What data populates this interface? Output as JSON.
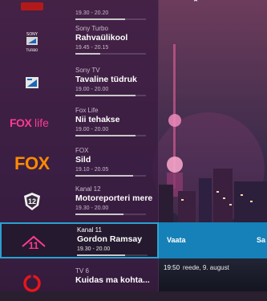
{
  "rows": [
    {
      "channel": "",
      "title": "",
      "time": "19.30 - 20.20",
      "progress": 0.7,
      "logo_text": "",
      "logo": "tv-logo-cropped",
      "favorite": true
    },
    {
      "channel": "Sony Turbo",
      "title": "Rahvaülikool",
      "time": "19.45 - 20.15",
      "progress": 0.35,
      "logo_text": "SONY TURBO",
      "logo": "sony-turbo-logo"
    },
    {
      "channel": "Sony TV",
      "title": "Tavaline tüdruk",
      "time": "19.00 - 20.00",
      "progress": 0.85,
      "logo_text": "",
      "logo": "sony-tv-logo"
    },
    {
      "channel": "Fox Life",
      "title": "Nii tehakse",
      "time": "19.00 - 20.00",
      "progress": 0.85,
      "logo_text": "FOXlife",
      "logo": "fox-life-logo"
    },
    {
      "channel": "FOX",
      "title": "Sild",
      "time": "19.10 - 20.05",
      "progress": 0.82,
      "logo_text": "FOX",
      "logo": "fox-logo"
    },
    {
      "channel": "Kanal 12",
      "title": "Motoreporteri mere",
      "time": "19.30 - 20.00",
      "progress": 0.68,
      "logo_text": "12",
      "logo": "kanal-12-logo"
    },
    {
      "channel": "Kanal 11",
      "title": "Gordon Ramsay",
      "time": "19.30 - 20.00",
      "progress": 0.68,
      "logo_text": "11",
      "logo": "kanal-11-logo",
      "selected": true
    },
    {
      "channel": "TV 6",
      "title": "Kuidas ma kohta...",
      "time": "",
      "progress": 0.0,
      "logo_text": "",
      "logo": "tv6-logo"
    }
  ],
  "actions": {
    "watch": "Vaata",
    "next": "Sa"
  },
  "status": {
    "clock": "19:50",
    "date": "reede, 9. august"
  },
  "colors": {
    "accent": "#1681b8",
    "panel": "#3c1c42",
    "fox_pink": "#ff3b91",
    "fox_orange": "#ff8a00"
  }
}
